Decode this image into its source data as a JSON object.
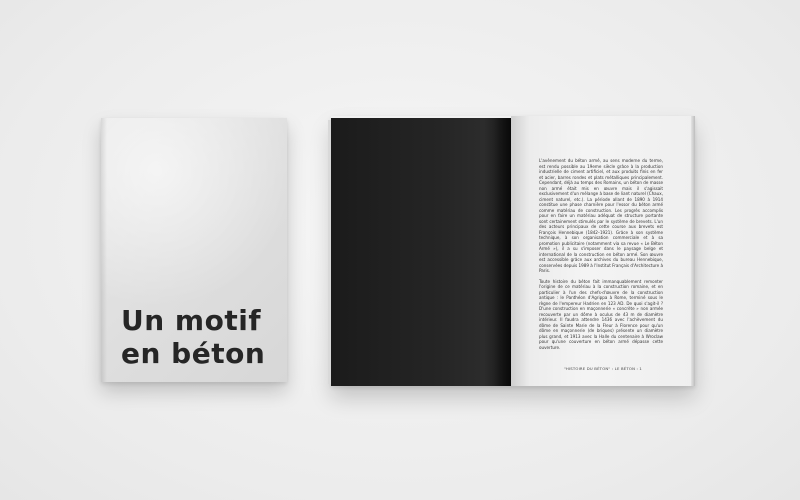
{
  "cover": {
    "title_line1": "Un motif",
    "title_line2": "en béton"
  },
  "spread": {
    "paragraph1": "L'avènement du béton armé, au sens moderne du terme, est rendu possible au 19eme siècle grâce à la production industrielle de ciment artificiel, et aux produits finis en fer et acier, barres rondes et plats métalliques principalement. Cependant, déjà au temps des Romains, un béton de masse non armé était mis en œuvre mais il s'agissait exclusivement d'un mélange à base de liant naturel (Chaux, ciment naturel, etc.). La période allant de 1890 à 1914 constitue une phase charnière pour l'essor du béton armé comme matériau de construction. Les progrès accomplis pour en faire un matériau adéquat de structure portante sont certainement stimulés par le système de brevets. L'un des acteurs principaux de cette course aux brevets est François Hennebique (1842–1921). Grâce à son système technique, à son organisation commerciale et à sa promotion publicitaire (notamment via sa revue « Le Béton Armé »), il a su s'imposer dans le paysage belge et international de la construction en béton armé. Son œuvre est accessible grâce aux archives du bureau Hennebique, conservées depuis 1989 à l'Institut Français d'Architecture à Paris.",
    "paragraph2": "Toute histoire du béton fait immanquablement remonter l'origine de ce matériau à la construction romaine, et en particulier à l'un des chefs-d'œuvre de la construction antique : le Panthéon d'Agrippa à Rome, terminé sous le règne de l'empereur Hadrien en 123 AD. De quoi s'agit-il ? D'une construction en maçonnerie « concrète » non armée recouverte par un dôme à oculus de 43 m de diamètre intérieur. Il faudra attendre 1436 avec l'achèvement du dôme de Sainte Marie de la Fleur à Florence pour qu'un dôme en maçonnerie (de briques) présente un diamètre plus grand, et 1913 avec la Halle du centenaire à Wroclaw pour qu'une couverture en béton armé dépasse cette ouverture.",
    "footer": "\"HISTOIRE DU BÉTON\" : LE BÉTON : 1"
  },
  "colors": {
    "background": "#efefef",
    "cover_paper": "#dedede",
    "title_ink": "#262626",
    "dark_page": "#1f1f1f",
    "light_page": "#f1f1f1"
  }
}
